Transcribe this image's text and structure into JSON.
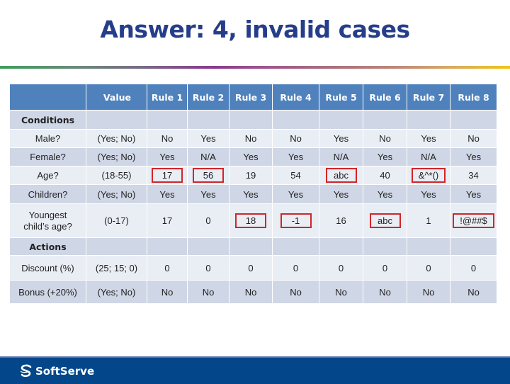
{
  "title": "Answer: 4, invalid cases",
  "table": {
    "headers": [
      "",
      "Value",
      "Rule 1",
      "Rule 2",
      "Rule 3",
      "Rule 4",
      "Rule 5",
      "Rule 6",
      "Rule 7",
      "Rule 8"
    ],
    "sections": {
      "conditions": "Conditions",
      "actions": "Actions"
    },
    "rows": [
      {
        "label": "Male?",
        "value": "(Yes; No)",
        "cells": [
          "No",
          "Yes",
          "No",
          "No",
          "Yes",
          "No",
          "Yes",
          "No"
        ],
        "invalid": [
          false,
          false,
          false,
          false,
          false,
          false,
          false,
          false
        ]
      },
      {
        "label": "Female?",
        "value": "(Yes; No)",
        "cells": [
          "Yes",
          "N/A",
          "Yes",
          "Yes",
          "N/A",
          "Yes",
          "N/A",
          "Yes"
        ],
        "invalid": [
          false,
          false,
          false,
          false,
          false,
          false,
          false,
          false
        ]
      },
      {
        "label": "Age?",
        "value": "(18-55)",
        "cells": [
          "17",
          "56",
          "19",
          "54",
          "abc",
          "40",
          "&^*()",
          "34"
        ],
        "invalid": [
          true,
          true,
          false,
          false,
          true,
          false,
          true,
          false
        ]
      },
      {
        "label": "Children?",
        "value": "(Yes; No)",
        "cells": [
          "Yes",
          "Yes",
          "Yes",
          "Yes",
          "Yes",
          "Yes",
          "Yes",
          "Yes"
        ],
        "invalid": [
          false,
          false,
          false,
          false,
          false,
          false,
          false,
          false
        ]
      },
      {
        "label": "Youngest child’s age?",
        "label_lines": [
          "Youngest",
          "child’s age?"
        ],
        "value": "(0-17)",
        "cells": [
          "17",
          "0",
          "18",
          "-1",
          "16",
          "abc",
          "1",
          "!@##$"
        ],
        "invalid": [
          false,
          false,
          true,
          true,
          false,
          true,
          false,
          true
        ]
      },
      {
        "label": "Discount (%)",
        "value": "(25; 15; 0)",
        "cells": [
          "0",
          "0",
          "0",
          "0",
          "0",
          "0",
          "0",
          "0"
        ],
        "invalid": [
          false,
          false,
          false,
          false,
          false,
          false,
          false,
          false
        ]
      },
      {
        "label": "Bonus (+20%)",
        "value": "(Yes; No)",
        "cells": [
          "No",
          "No",
          "No",
          "No",
          "No",
          "No",
          "No",
          "No"
        ],
        "invalid": [
          false,
          false,
          false,
          false,
          false,
          false,
          false,
          false
        ]
      }
    ]
  },
  "footer": {
    "logo_text": "SoftServe",
    "logo_icon": "softserve-logo-icon"
  },
  "colors": {
    "title": "#263e8a",
    "header_bg": "#4f81bd",
    "row_dark": "#cfd6e5",
    "row_light": "#e9edf4",
    "invalid_box": "#d0262a",
    "footer_bg": "#03478a"
  }
}
